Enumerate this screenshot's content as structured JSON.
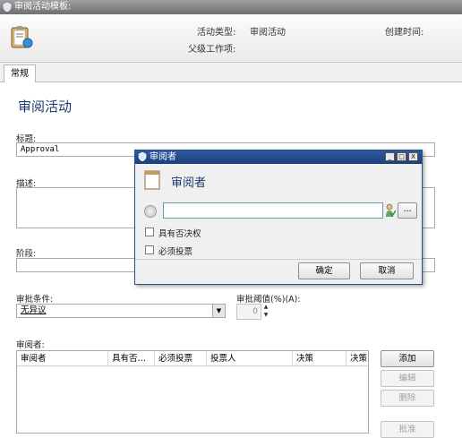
{
  "window": {
    "title": "审阅活动模板:"
  },
  "header": {
    "activity_type_label": "活动类型:",
    "activity_type_value": "审阅活动",
    "created_time_label": "创建时间:",
    "parent_item_label": "父级工作项:"
  },
  "tabs": [
    {
      "label": "常规"
    }
  ],
  "form": {
    "section_title": "审阅活动",
    "title_label": "标题:",
    "title_value": "Approval",
    "description_label": "描述:",
    "stage_label": "阶段:",
    "approval_condition_label": "审批条件:",
    "approval_condition_value": "无异议",
    "approval_threshold_label": "审批阈值(%)(A):",
    "approval_threshold_value": "0",
    "reviewers_label": "审阅者:",
    "reviewers_columns": [
      "审阅者",
      "具有否…",
      "必须投票",
      "投票人",
      "决策",
      "决策"
    ],
    "buttons": {
      "add": "添加",
      "edit": "编辑",
      "delete": "删除",
      "approve": "批准"
    }
  },
  "dialog": {
    "title": "审阅者",
    "heading": "审阅者",
    "browse_label": "...",
    "veto_label": "具有否决权",
    "must_vote_label": "必须投票",
    "ok_label": "确定",
    "cancel_label": "取消",
    "window_buttons": {
      "minimize": "_",
      "maximize": "□",
      "close": "X"
    }
  },
  "colors": {
    "title_blue": "#1f3b6b",
    "dialog_title_bar": "#2f5aa0"
  }
}
